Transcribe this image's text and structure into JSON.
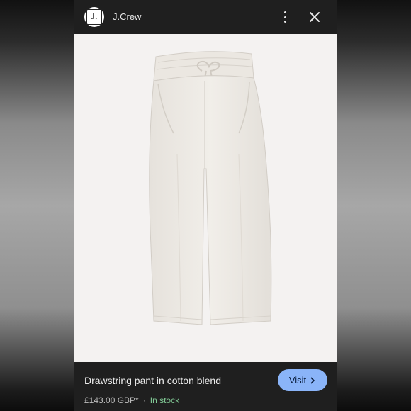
{
  "header": {
    "logo_text": "J.",
    "brand": "J.Crew",
    "more_icon": "more-vert-icon",
    "close_icon": "close-icon"
  },
  "product": {
    "image": "white drawstring pants",
    "title": "Drawstring pant in cotton blend",
    "price": "£143.00 GBP*",
    "separator": "·",
    "availability": "In stock"
  },
  "actions": {
    "visit_label": "Visit",
    "visit_icon": "chevron-right-icon"
  },
  "colors": {
    "panel_bg": "#1f1f1f",
    "accent": "#8ab4f8",
    "stock": "#81c995"
  }
}
